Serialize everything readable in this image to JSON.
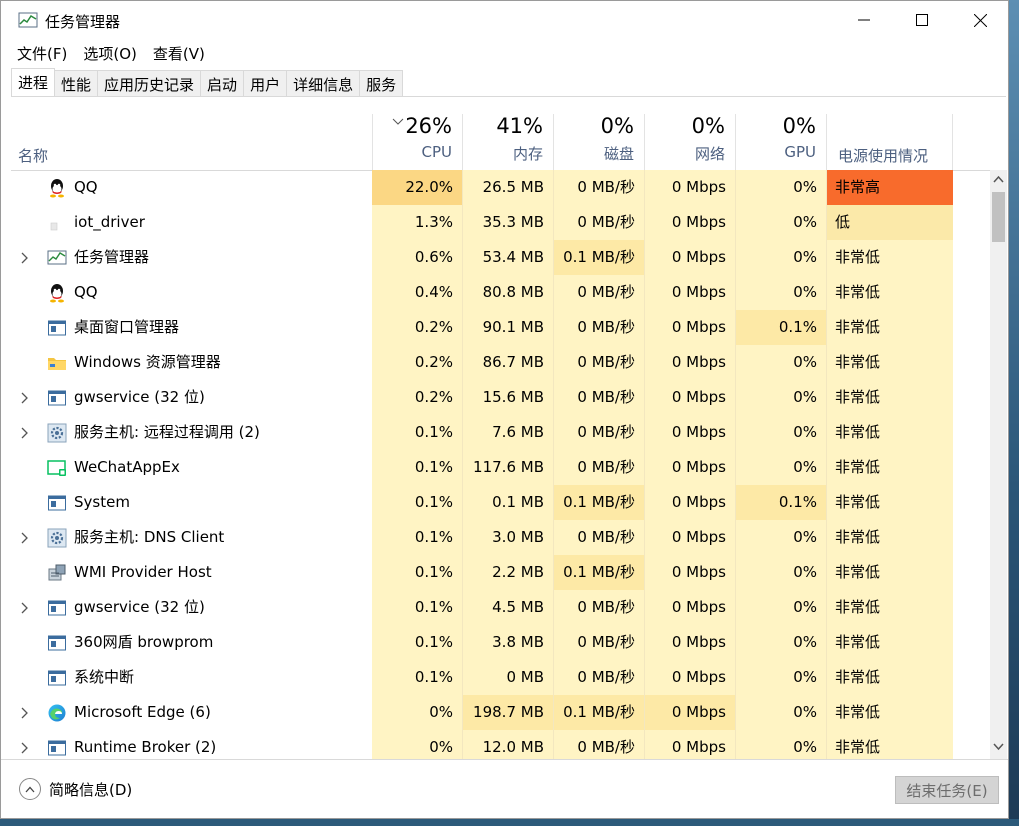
{
  "window": {
    "title": "任务管理器"
  },
  "menu": [
    "文件(F)",
    "选项(O)",
    "查看(V)"
  ],
  "tabs": [
    "进程",
    "性能",
    "应用历史记录",
    "启动",
    "用户",
    "详细信息",
    "服务"
  ],
  "header": {
    "name_label": "名称",
    "power_label": "电源使用情况",
    "columns": [
      {
        "pct": "26%",
        "label": "CPU"
      },
      {
        "pct": "41%",
        "label": "内存"
      },
      {
        "pct": "0%",
        "label": "磁盘"
      },
      {
        "pct": "0%",
        "label": "网络"
      },
      {
        "pct": "0%",
        "label": "GPU"
      }
    ]
  },
  "colors": {
    "cell_light": "#fff4c4",
    "cell_medium": "#fde9a6",
    "cell_strong": "#fbd784",
    "power_very_high": "#f86b2c",
    "power_low": "#fbe9a9",
    "power_very_low": "#fff4c4"
  },
  "processes": [
    {
      "name": "QQ",
      "icon": "qq-icon",
      "expandable": false,
      "cpu": "22.0%",
      "mem": "26.5 MB",
      "disk": "0 MB/秒",
      "net": "0 Mbps",
      "gpu": "0%",
      "power": "非常高",
      "heat": [
        "strong",
        "light",
        "light",
        "light",
        "light"
      ],
      "power_level": "very_high"
    },
    {
      "name": "iot_driver",
      "icon": "blank-app-icon",
      "expandable": false,
      "cpu": "1.3%",
      "mem": "35.3 MB",
      "disk": "0 MB/秒",
      "net": "0 Mbps",
      "gpu": "0%",
      "power": "低",
      "heat": [
        "light",
        "light",
        "light",
        "light",
        "light"
      ],
      "power_level": "low"
    },
    {
      "name": "任务管理器",
      "icon": "task-manager-icon",
      "expandable": true,
      "cpu": "0.6%",
      "mem": "53.4 MB",
      "disk": "0.1 MB/秒",
      "net": "0 Mbps",
      "gpu": "0%",
      "power": "非常低",
      "heat": [
        "light",
        "light",
        "medium",
        "light",
        "light"
      ],
      "power_level": "very_low"
    },
    {
      "name": "QQ",
      "icon": "qq-icon",
      "expandable": false,
      "cpu": "0.4%",
      "mem": "80.8 MB",
      "disk": "0 MB/秒",
      "net": "0 Mbps",
      "gpu": "0%",
      "power": "非常低",
      "heat": [
        "light",
        "light",
        "light",
        "light",
        "light"
      ],
      "power_level": "very_low"
    },
    {
      "name": "桌面窗口管理器",
      "icon": "window-app-icon",
      "expandable": false,
      "cpu": "0.2%",
      "mem": "90.1 MB",
      "disk": "0 MB/秒",
      "net": "0 Mbps",
      "gpu": "0.1%",
      "power": "非常低",
      "heat": [
        "light",
        "light",
        "light",
        "light",
        "medium"
      ],
      "power_level": "very_low"
    },
    {
      "name": "Windows 资源管理器",
      "icon": "folder-icon",
      "expandable": false,
      "cpu": "0.2%",
      "mem": "86.7 MB",
      "disk": "0 MB/秒",
      "net": "0 Mbps",
      "gpu": "0%",
      "power": "非常低",
      "heat": [
        "light",
        "light",
        "light",
        "light",
        "light"
      ],
      "power_level": "very_low"
    },
    {
      "name": "gwservice (32 位)",
      "icon": "window-app-icon",
      "expandable": true,
      "cpu": "0.2%",
      "mem": "15.6 MB",
      "disk": "0 MB/秒",
      "net": "0 Mbps",
      "gpu": "0%",
      "power": "非常低",
      "heat": [
        "light",
        "light",
        "light",
        "light",
        "light"
      ],
      "power_level": "very_low"
    },
    {
      "name": "服务主机: 远程过程调用 (2)",
      "icon": "gear-icon",
      "expandable": true,
      "cpu": "0.1%",
      "mem": "7.6 MB",
      "disk": "0 MB/秒",
      "net": "0 Mbps",
      "gpu": "0%",
      "power": "非常低",
      "heat": [
        "light",
        "light",
        "light",
        "light",
        "light"
      ],
      "power_level": "very_low"
    },
    {
      "name": "WeChatAppEx",
      "icon": "wechat-icon",
      "expandable": false,
      "cpu": "0.1%",
      "mem": "117.6 MB",
      "disk": "0 MB/秒",
      "net": "0 Mbps",
      "gpu": "0%",
      "power": "非常低",
      "heat": [
        "light",
        "light",
        "light",
        "light",
        "light"
      ],
      "power_level": "very_low"
    },
    {
      "name": "System",
      "icon": "window-app-icon",
      "expandable": false,
      "cpu": "0.1%",
      "mem": "0.1 MB",
      "disk": "0.1 MB/秒",
      "net": "0 Mbps",
      "gpu": "0.1%",
      "power": "非常低",
      "heat": [
        "light",
        "light",
        "medium",
        "light",
        "medium"
      ],
      "power_level": "very_low"
    },
    {
      "name": "服务主机: DNS Client",
      "icon": "gear-icon",
      "expandable": true,
      "cpu": "0.1%",
      "mem": "3.0 MB",
      "disk": "0 MB/秒",
      "net": "0 Mbps",
      "gpu": "0%",
      "power": "非常低",
      "heat": [
        "light",
        "light",
        "light",
        "light",
        "light"
      ],
      "power_level": "very_low"
    },
    {
      "name": "WMI Provider Host",
      "icon": "wmi-icon",
      "expandable": false,
      "cpu": "0.1%",
      "mem": "2.2 MB",
      "disk": "0.1 MB/秒",
      "net": "0 Mbps",
      "gpu": "0%",
      "power": "非常低",
      "heat": [
        "light",
        "light",
        "medium",
        "light",
        "light"
      ],
      "power_level": "very_low"
    },
    {
      "name": "gwservice (32 位)",
      "icon": "window-app-icon",
      "expandable": true,
      "cpu": "0.1%",
      "mem": "4.5 MB",
      "disk": "0 MB/秒",
      "net": "0 Mbps",
      "gpu": "0%",
      "power": "非常低",
      "heat": [
        "light",
        "light",
        "light",
        "light",
        "light"
      ],
      "power_level": "very_low"
    },
    {
      "name": "360网盾 browprom",
      "icon": "window-app-icon",
      "expandable": false,
      "cpu": "0.1%",
      "mem": "3.8 MB",
      "disk": "0 MB/秒",
      "net": "0 Mbps",
      "gpu": "0%",
      "power": "非常低",
      "heat": [
        "light",
        "light",
        "light",
        "light",
        "light"
      ],
      "power_level": "very_low"
    },
    {
      "name": "系统中断",
      "icon": "window-app-icon",
      "expandable": false,
      "cpu": "0.1%",
      "mem": "0 MB",
      "disk": "0 MB/秒",
      "net": "0 Mbps",
      "gpu": "0%",
      "power": "非常低",
      "heat": [
        "light",
        "light",
        "light",
        "light",
        "light"
      ],
      "power_level": "very_low"
    },
    {
      "name": "Microsoft Edge (6)",
      "icon": "edge-icon",
      "expandable": true,
      "cpu": "0%",
      "mem": "198.7 MB",
      "disk": "0.1 MB/秒",
      "net": "0 Mbps",
      "gpu": "0%",
      "power": "非常低",
      "heat": [
        "light",
        "medium",
        "medium",
        "medium",
        "light"
      ],
      "power_level": "very_low"
    },
    {
      "name": "Runtime Broker (2)",
      "icon": "window-app-icon",
      "expandable": true,
      "cpu": "0%",
      "mem": "12.0 MB",
      "disk": "0 MB/秒",
      "net": "0 Mbps",
      "gpu": "0%",
      "power": "非常低",
      "heat": [
        "light",
        "light",
        "light",
        "light",
        "light"
      ],
      "power_level": "very_low"
    }
  ],
  "footer": {
    "fewer_details": "简略信息(D)",
    "end_task": "结束任务(E)"
  }
}
